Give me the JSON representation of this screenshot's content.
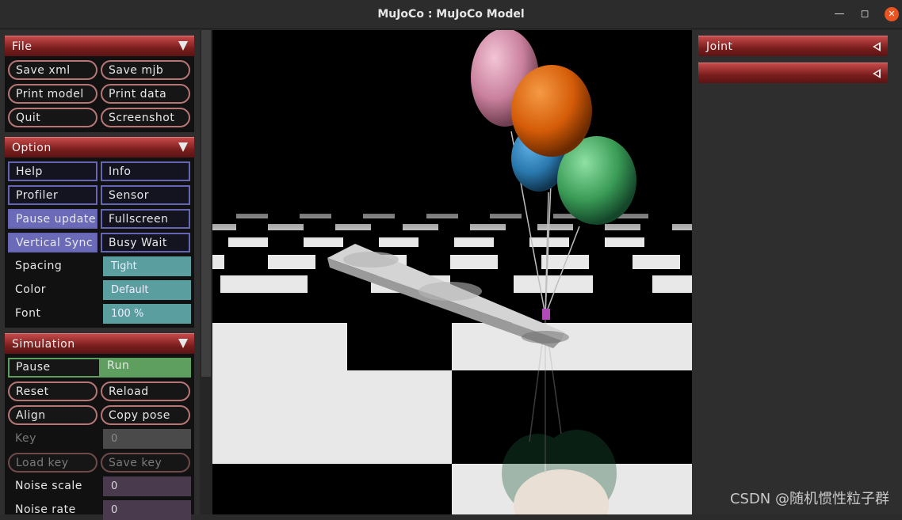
{
  "window": {
    "title": "MuJoCo : MuJoCo Model",
    "min_icon": "minimize-icon",
    "max_icon": "maximize-icon",
    "close_icon": "close-icon"
  },
  "file_section": {
    "title": "File",
    "buttons": [
      "Save xml",
      "Save mjb",
      "Print model",
      "Print data",
      "Quit",
      "Screenshot"
    ]
  },
  "option_section": {
    "title": "Option",
    "toggles": [
      {
        "label": "Help",
        "on": false
      },
      {
        "label": "Info",
        "on": false
      },
      {
        "label": "Profiler",
        "on": false
      },
      {
        "label": "Sensor",
        "on": false
      },
      {
        "label": "Pause update",
        "on": true
      },
      {
        "label": "Fullscreen",
        "on": false
      },
      {
        "label": "Vertical Sync",
        "on": true
      },
      {
        "label": "Busy Wait",
        "on": false
      }
    ],
    "spacing_label": "Spacing",
    "spacing_value": "Tight",
    "color_label": "Color",
    "color_value": "Default",
    "font_label": "Font",
    "font_value": "100 %"
  },
  "simulation_section": {
    "title": "Simulation",
    "pause_label": "Pause",
    "run_label": "Run",
    "reset": "Reset",
    "reload": "Reload",
    "align": "Align",
    "copy_pose": "Copy pose",
    "key_label": "Key",
    "key_value": "0",
    "load_key": "Load key",
    "save_key": "Save key",
    "noise_scale_label": "Noise scale",
    "noise_scale_value": "0",
    "noise_rate_label": "Noise rate",
    "noise_rate_value": "0"
  },
  "right_panel": {
    "joint_title": "Joint",
    "second_title": ""
  },
  "scene": {
    "balloon_colors": [
      "#d98aa8",
      "#e0650d",
      "#2f86c0",
      "#3aa35a"
    ],
    "floor": "checker"
  },
  "watermark": "CSDN @随机惯性粒子群",
  "colors": {
    "header_red": "#8b2323",
    "toggle_blue": "#6a6ab8",
    "teal": "#5a9ea0",
    "run_green": "#5e9e5e"
  }
}
